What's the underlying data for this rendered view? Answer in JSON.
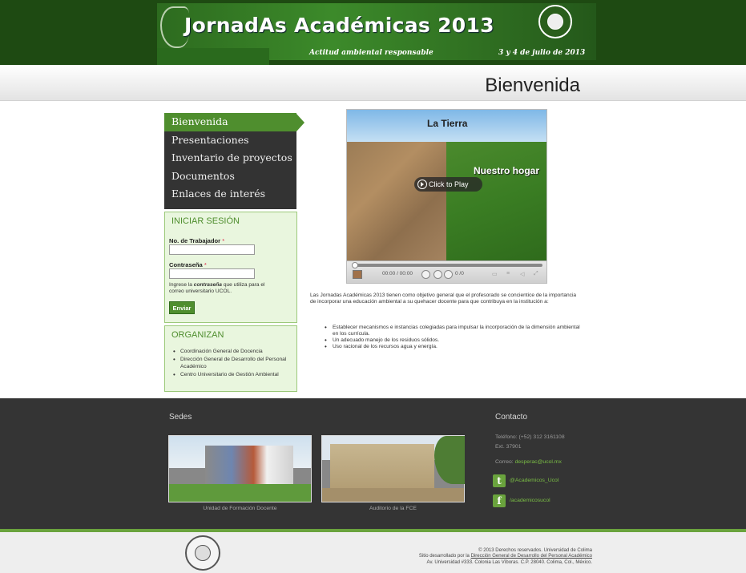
{
  "header": {
    "title": "JornadAs Académicas 2013",
    "slogan": "Actitud ambiental responsable",
    "date": "3 y 4 de julio de 2013",
    "brand_color": "#1e4a12"
  },
  "page_title": "Bienvenida",
  "nav": {
    "items": [
      {
        "label": "Bienvenida",
        "active": true
      },
      {
        "label": "Presentaciones"
      },
      {
        "label": "Inventario de proyectos"
      },
      {
        "label": "Documentos"
      },
      {
        "label": "Enlaces de interés"
      }
    ],
    "accent_color": "#4f8e2e"
  },
  "login": {
    "title": "INICIAR SESIÓN",
    "worker_label": "No. de Trabajador",
    "worker_value": "",
    "password_label": "Contraseña",
    "password_value": "",
    "required_mark": "*",
    "help_prefix": "Ingrese la ",
    "help_emph": "contraseña",
    "help_suffix": " que utiliza para el correo universitario UCOL.",
    "submit_label": "Enviar"
  },
  "organizers": {
    "title": "ORGANIZAN",
    "items": [
      "Coordinación General de Docencia",
      "Dirección General de Desarrollo del Personal Académico",
      "Centro Universitario de Gestión Ambiental"
    ]
  },
  "video": {
    "title": "La Tierra",
    "subtitle": "Nuestro hogar",
    "play_label": "Click to Play",
    "time": "00:00 / 00:00",
    "counter": "0 /0",
    "progress": 0
  },
  "intro": "Las Jornadas Académicas 2013 tienen como objetivo general que el profesorado se concientice de la importancia de incorporar una educación ambiental a su quehacer docente para que contribuya en la institución a:",
  "goals": [
    "Establecer mecanismos e instancias colegiadas para impulsar la incorporación de la dimensión ambiental en los currícula.",
    "Un adecuado manejo de los residuos sólidos.",
    "Uso racional de los recursos agua y energía."
  ],
  "footer": {
    "venues_title": "Sedes",
    "venues": [
      {
        "caption": "Unidad de Formación Docente"
      },
      {
        "caption": "Auditorio de la FCE"
      }
    ],
    "contact_title": "Contacto",
    "phone_label": "Teléfono:",
    "phone_value": "(+52) 312 3161108",
    "ext": "Ext. 37901",
    "email_label": "Correo:",
    "email_value": "desperac@ucol.mx",
    "twitter": "@Academicos_Ucol",
    "facebook": "/academicosucol"
  },
  "credits": {
    "copyright": "© 2013 Derechos reservados. Universidad de Colima",
    "developed_prefix": "Sitio desarrollado por la",
    "developed_link": "Dirección General de Desarrollo del Personal Académico",
    "address": "Av. Universidad #333. Colonia Las Víboras. C.P. 28040. Colima, Col., México."
  }
}
